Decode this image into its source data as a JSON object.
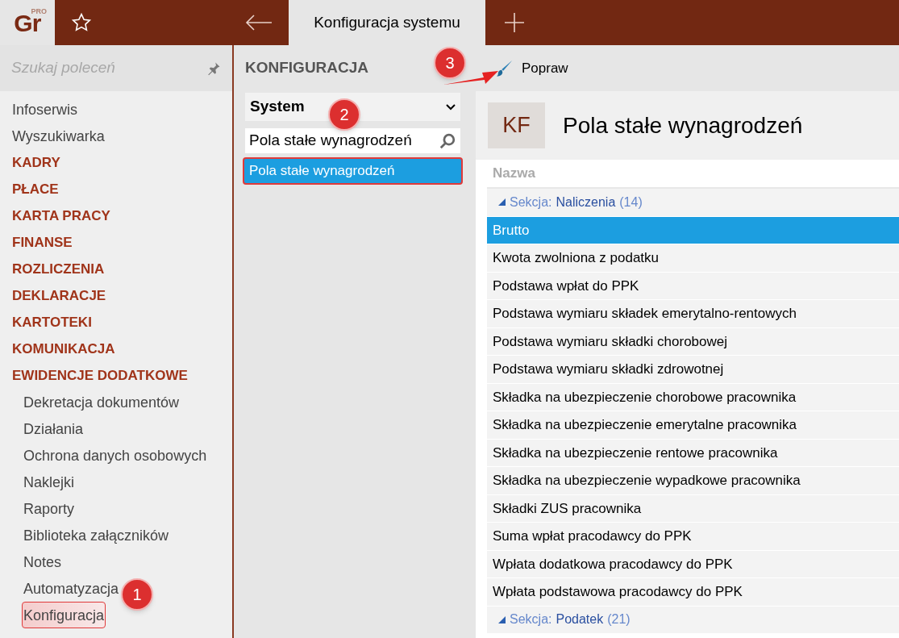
{
  "logo": {
    "text": "Gr",
    "badge": "PRO"
  },
  "tab": {
    "title": "Konfiguracja systemu"
  },
  "sidebar": {
    "search": {
      "placeholder": "Szukaj poleceń"
    },
    "items": [
      {
        "label": "Infoserwis",
        "kind": "link",
        "selected": false
      },
      {
        "label": "Wyszukiwarka",
        "kind": "link",
        "selected": false
      },
      {
        "label": "KADRY",
        "kind": "category",
        "selected": false
      },
      {
        "label": "PŁACE",
        "kind": "category",
        "selected": false
      },
      {
        "label": "KARTA PRACY",
        "kind": "category",
        "selected": false
      },
      {
        "label": "FINANSE",
        "kind": "category",
        "selected": false
      },
      {
        "label": "ROZLICZENIA",
        "kind": "category",
        "selected": false
      },
      {
        "label": "DEKLARACJE",
        "kind": "category",
        "selected": false
      },
      {
        "label": "KARTOTEKI",
        "kind": "category",
        "selected": false
      },
      {
        "label": "KOMUNIKACJA",
        "kind": "category",
        "selected": false
      },
      {
        "label": "EWIDENCJE DODATKOWE",
        "kind": "category",
        "selected": false,
        "children": [
          {
            "label": "Dekretacja dokumentów",
            "selected": false
          },
          {
            "label": "Działania",
            "selected": false
          },
          {
            "label": "Ochrona danych osobowych",
            "selected": false
          },
          {
            "label": "Naklejki",
            "selected": false
          },
          {
            "label": "Raporty",
            "selected": false
          },
          {
            "label": "Biblioteka załączników",
            "selected": false
          },
          {
            "label": "Notes",
            "selected": false
          },
          {
            "label": "Automatyzacja",
            "selected": false
          },
          {
            "label": "Konfiguracja",
            "selected": true
          }
        ]
      }
    ]
  },
  "config": {
    "heading": "KONFIGURACJA",
    "dropdown": {
      "value": "System"
    },
    "search": {
      "value": "Pola stałe wynagrodzeń"
    },
    "results": [
      {
        "label": "Pola stałe wynagrodzeń",
        "selected": true
      }
    ]
  },
  "toolbar": {
    "buttons": [
      "Popraw"
    ]
  },
  "record": {
    "initials": "KF",
    "title": "Pola stałe wynagrodzeń"
  },
  "table": {
    "columns": [
      "Nazwa"
    ],
    "sections": [
      {
        "label": "Sekcja:",
        "name": "Naliczenia",
        "count": "(14)",
        "expanded": true,
        "rows": [
          {
            "name": "Brutto",
            "selected": true
          },
          {
            "name": "Kwota zwolniona z podatku",
            "selected": false
          },
          {
            "name": "Podstawa wpłat do PPK",
            "selected": false
          },
          {
            "name": "Podstawa wymiaru składek emerytalno-rentowych",
            "selected": false
          },
          {
            "name": "Podstawa wymiaru składki chorobowej",
            "selected": false
          },
          {
            "name": "Podstawa wymiaru składki zdrowotnej",
            "selected": false
          },
          {
            "name": "Składka na ubezpieczenie chorobowe pracownika",
            "selected": false
          },
          {
            "name": "Składka na ubezpieczenie emerytalne pracownika",
            "selected": false
          },
          {
            "name": "Składka na ubezpieczenie rentowe pracownika",
            "selected": false
          },
          {
            "name": "Składka na ubezpieczenie wypadkowe pracownika",
            "selected": false
          },
          {
            "name": "Składki ZUS pracownika",
            "selected": false
          },
          {
            "name": "Suma wpłat pracodawcy do PPK",
            "selected": false
          },
          {
            "name": "Wpłata dodatkowa pracodawcy do PPK",
            "selected": false
          },
          {
            "name": "Wpłata podstawowa pracodawcy do PPK",
            "selected": false
          }
        ]
      },
      {
        "label": "Sekcja:",
        "name": "Podatek",
        "count": "(21)",
        "expanded": true
      }
    ]
  },
  "callouts": [
    "1",
    "2",
    "3"
  ]
}
